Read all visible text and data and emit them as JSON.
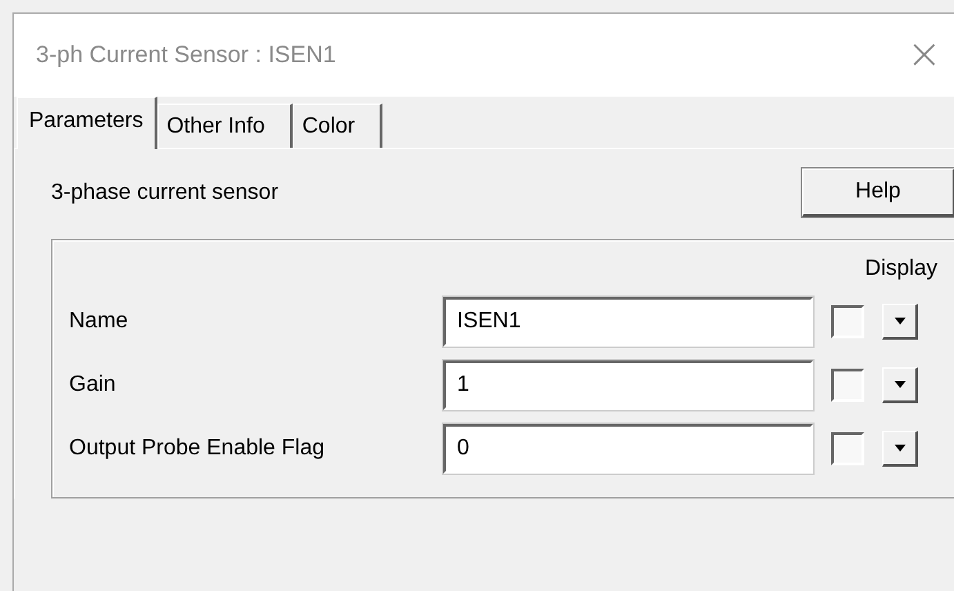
{
  "window": {
    "title": "3-ph Current Sensor : ISEN1",
    "close": "×"
  },
  "tabs": [
    {
      "label": "Parameters",
      "selected": true
    },
    {
      "label": "Other Info",
      "selected": false
    },
    {
      "label": "Color",
      "selected": false
    }
  ],
  "description": "3-phase current sensor",
  "help_button": "Help",
  "display_header": "Display",
  "params": [
    {
      "label": "Name",
      "value": "ISEN1",
      "display": false
    },
    {
      "label": "Gain",
      "value": "1",
      "display": false
    },
    {
      "label": "Output Probe Enable Flag",
      "value": "0",
      "display": false
    }
  ]
}
